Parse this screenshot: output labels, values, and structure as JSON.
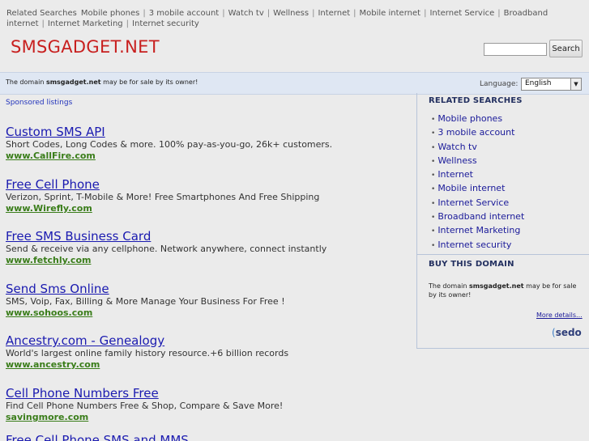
{
  "topnav": {
    "lead": "Related Searches",
    "items": [
      "Mobile phones",
      "3 mobile account",
      "Watch tv",
      "Wellness",
      "Internet",
      "Mobile internet",
      "Internet Service",
      "Broadband internet",
      "Internet Marketing",
      "Internet security"
    ]
  },
  "header": {
    "site_title": "SMSGADGET.NET",
    "search_value": "",
    "search_button": "Search"
  },
  "info_bar": {
    "text_before": "The domain ",
    "domain": "smsgadget.net",
    "text_after": " may be for sale by its owner!",
    "language_label": "Language:",
    "language_value": "English"
  },
  "main": {
    "sponsored_label": "Sponsored listings",
    "listings": [
      {
        "title": "Custom SMS API",
        "desc": "Short Codes, Long Codes & more. 100% pay-as-you-go, 26k+ customers.",
        "url": "www.CallFire.com"
      },
      {
        "title": "Free Cell Phone",
        "desc": "Verizon, Sprint, T-Mobile & More! Free Smartphones And Free Shipping",
        "url": "www.Wirefly.com"
      },
      {
        "title": "Free SMS Business Card",
        "desc": "Send & receive via any cellphone. Network anywhere, connect instantly",
        "url": "www.fetchly.com"
      },
      {
        "title": "Send Sms Online",
        "desc": "SMS, Voip, Fax, Billing & More Manage Your Business For Free !",
        "url": "www.sohoos.com"
      },
      {
        "title": "Ancestry.com - Genealogy",
        "desc": "World's largest online family history resource.+6 billion records",
        "url": "www.ancestry.com"
      },
      {
        "title": "Cell Phone Numbers Free",
        "desc": "Find Cell Phone Numbers Free & Shop, Compare & Save More!",
        "url": "savingmore.com"
      },
      {
        "title": "Free Cell Phone SMS and MMS",
        "desc": "",
        "url": ""
      }
    ]
  },
  "sidebar": {
    "related_heading": "RELATED SEARCHES",
    "related": [
      "Mobile phones",
      "3 mobile account",
      "Watch tv",
      "Wellness",
      "Internet",
      "Mobile internet",
      "Internet Service",
      "Broadband internet",
      "Internet Marketing",
      "Internet security"
    ],
    "buy_heading": "BUY THIS DOMAIN",
    "buy_before": "The domain ",
    "buy_domain": "smsgadget.net",
    "buy_after": " may be for sale by its owner!",
    "more_details": "More details...",
    "sedo_logo": "sedo"
  },
  "colors": {
    "title_red": "#c8201f",
    "link_blue": "#1a1ab0",
    "url_green": "#3a7d1a",
    "info_bar_bg": "#dfe7f3"
  }
}
